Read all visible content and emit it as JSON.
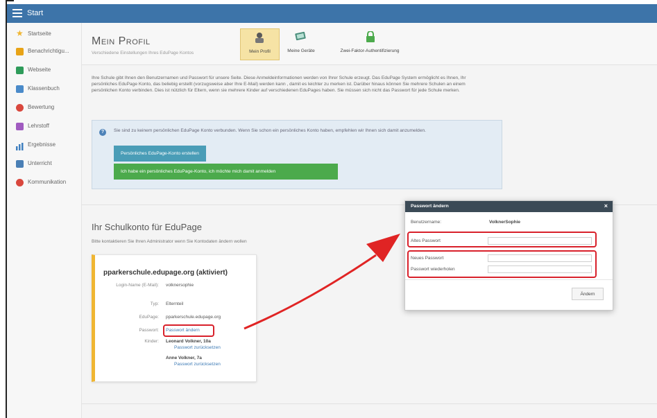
{
  "topbar": {
    "start_label": "Start"
  },
  "sidebar": {
    "items": [
      {
        "label": "Startseite",
        "icon": "star-icon",
        "color": "#f0b632"
      },
      {
        "label": "Benachrichtigu...",
        "icon": "mail-icon",
        "color": "#e8a317"
      },
      {
        "label": "Webseite",
        "icon": "web-icon",
        "color": "#2e9b5a"
      },
      {
        "label": "Klassenbuch",
        "icon": "book-icon",
        "color": "#4a8ac9"
      },
      {
        "label": "Bewertung",
        "icon": "grade-icon",
        "color": "#d9473d"
      },
      {
        "label": "Lehrstoff",
        "icon": "lesson-icon",
        "color": "#a05bc0"
      },
      {
        "label": "Ergebnisse",
        "icon": "chart-icon",
        "color": "#3f7fbf"
      },
      {
        "label": "Unterricht",
        "icon": "class-icon",
        "color": "#4a7fb5"
      },
      {
        "label": "Kommunikation",
        "icon": "chat-icon",
        "color": "#d9473d"
      }
    ]
  },
  "header": {
    "title": "Mein Profil",
    "subtitle": "Verschiedene Einstellungen Ihres EduPage Kontos",
    "tabs": [
      {
        "label": "Mein Profil",
        "icon": "profile-icon"
      },
      {
        "label": "Meine Geräte",
        "icon": "devices-icon"
      },
      {
        "label": "Zwei-Faktor-Authentifizierung",
        "icon": "lock-icon"
      }
    ]
  },
  "intro_text": "Ihre Schule gibt Ihnen den Benutzernamen und Passwort für unsere Seite. Diese Anmeldeinformationen werden von Ihrer Schule erzeugt. Das EduPage System ermöglicht es Ihnen, Ihr persönliches EduPage Konto, das beliebig erstellt (vorzugsweise aber Ihre E-Mail) werden kann , damit es leichter zu merken ist. Darüber hinaus können Sie mehrere Schulen an einem persönlichen Konto verbinden. Dies ist nützlich für Eltern, wenn sie mehrere Kinder auf verschiedenen EduPages haben. Sie müssen sich nicht das Passwort für jede Schule merken.",
  "info_box": {
    "text": "Sie sind zu keinem persönlichen EduPage Konto verbunden. Wenn Sie schon ein persönliches Konto haben, empfehlen wir Ihnen sich damit anzumelden.",
    "create_button": "Persönliches EduPage-Konto erstellen",
    "login_button": "Ich habe ein persönliches EduPage-Konto, ich möchte mich damit anmelden"
  },
  "school_section": {
    "title": "Ihr Schulkonto für EduPage",
    "description": "Bitte kontaktieren Sie Ihren Administrator wenn Sie Kontodaten ändern wollen",
    "card": {
      "title": "pparkerschule.edupage.org (aktiviert)",
      "login_label": "Login-Name (E-Mail):",
      "login_value": "volknersophie",
      "type_label": "Typ:",
      "type_value": "Elternteil",
      "edupage_label": "EduPage:",
      "edupage_value": "pparkerschule.edupage.org",
      "password_label": "Passwort:",
      "password_link": "Passwort ändern",
      "children_label": "Kinder:",
      "child1_name": "Leonard Volkner, 10a",
      "child1_link": "Passwort zurücksetzen",
      "child2_name": "Anne Volkner, 7a",
      "child2_link": "Passwort zurücksetzen"
    }
  },
  "dialog": {
    "title": "Passwort ändern",
    "close": "×",
    "username_label": "Benutzername:",
    "username_value": "VolknerSophie",
    "old_password_label": "Altes Passwort",
    "new_password_label": "Neues Passwort",
    "repeat_password_label": "Passwort wiederholen",
    "submit_label": "Ändern"
  },
  "colors": {
    "topbar": "#3d74a9",
    "highlight": "#d8202a",
    "green_button": "#4caa4c",
    "blue_button": "#4a9db7",
    "card_accent": "#f0b632"
  }
}
